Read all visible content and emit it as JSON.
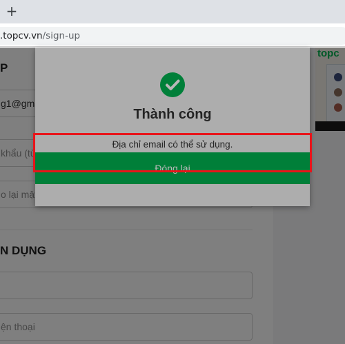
{
  "browser": {
    "new_tab_symbol": "+",
    "url_host": ".topcv.vn",
    "url_path": "/sign-up"
  },
  "form": {
    "section_heading_1": "P",
    "email_value": "g1@gmail.com",
    "password_placeholder": "khẩu (từ 6 đến 25 ký tự)",
    "confirm_placeholder": "o lại mật khẩu",
    "section_heading_2": "N DỤNG",
    "phone_placeholder": "ện thoại"
  },
  "promo": {
    "logo_text": "topc"
  },
  "dialog": {
    "icon": "check-circle-icon",
    "title": "Thành công",
    "message": "Địa chỉ email có thể sử dụng.",
    "close_label": "Đóng lại"
  },
  "colors": {
    "accent": "#00b14f",
    "highlight": "#e8141a"
  }
}
